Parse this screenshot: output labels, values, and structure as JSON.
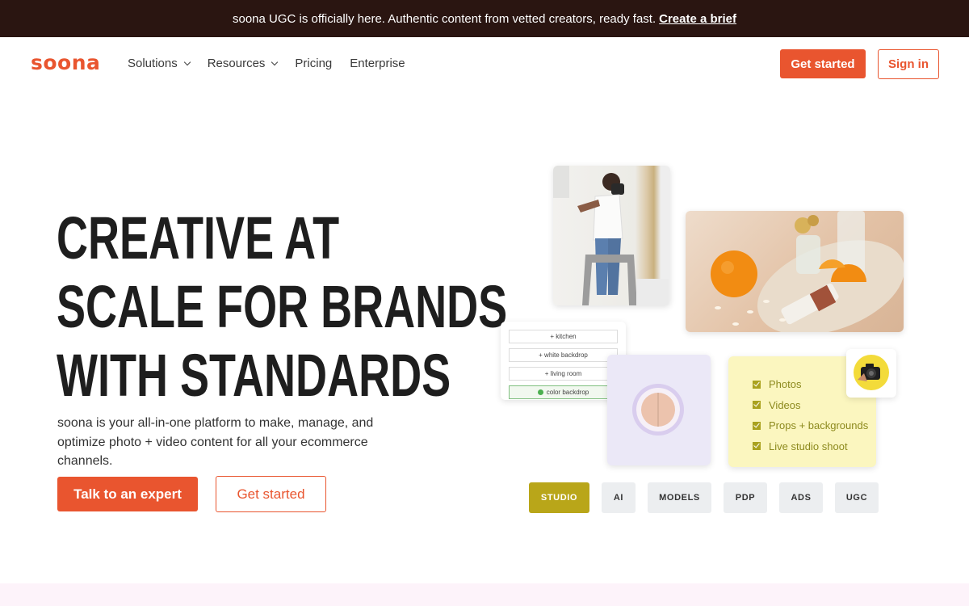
{
  "announcement": {
    "text": "soona UGC is officially here. Authentic content from vetted creators, ready fast.",
    "link": "Create a brief"
  },
  "nav": {
    "logo": "soona",
    "links": [
      {
        "label": "Solutions",
        "has_dropdown": true
      },
      {
        "label": "Resources",
        "has_dropdown": true
      },
      {
        "label": "Pricing",
        "has_dropdown": false
      },
      {
        "label": "Enterprise",
        "has_dropdown": false
      }
    ],
    "get_started": "Get started",
    "sign_in": "Sign in"
  },
  "hero": {
    "headline_lines": [
      "CREATIVE AT",
      "SCALE FOR BRANDS",
      "WITH STANDARDS"
    ],
    "subtext": "soona is your all-in-one platform to make, manage, and optimize photo + video content for all your ecommerce channels.",
    "primary_cta": "Talk to an expert",
    "secondary_cta": "Get started"
  },
  "collage": {
    "tags": [
      "+ kitchen",
      "+ white backdrop",
      "+ living room",
      "color backdrop"
    ],
    "checklist": [
      "Photos",
      "Videos",
      "Props + backgrounds",
      "Live studio shoot"
    ]
  },
  "pills": [
    {
      "label": "STUDIO",
      "active": true
    },
    {
      "label": "AI",
      "active": false
    },
    {
      "label": "MODELS",
      "active": false
    },
    {
      "label": "PDP",
      "active": false
    },
    {
      "label": "ADS",
      "active": false
    },
    {
      "label": "UGC",
      "active": false
    }
  ],
  "colors": {
    "brand": "#e9552f",
    "announcement_bg": "#2a1511",
    "pill_active": "#b9a619",
    "checklist_bg": "#fbf6bf"
  }
}
